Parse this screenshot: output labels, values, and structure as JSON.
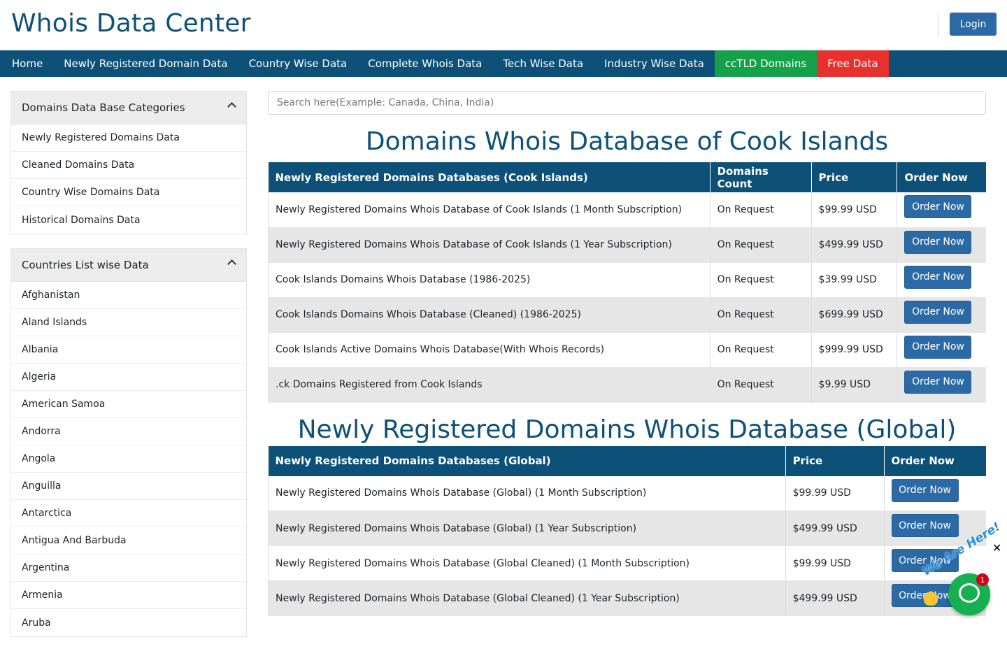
{
  "header": {
    "logo": "Whois Data Center",
    "login_label": "Login"
  },
  "nav": [
    {
      "label": "Home",
      "style": ""
    },
    {
      "label": "Newly Registered Domain Data",
      "style": ""
    },
    {
      "label": "Country Wise Data",
      "style": ""
    },
    {
      "label": "Complete Whois Data",
      "style": ""
    },
    {
      "label": "Tech Wise Data",
      "style": ""
    },
    {
      "label": "Industry Wise Data",
      "style": ""
    },
    {
      "label": "ccTLD Domains",
      "style": "green"
    },
    {
      "label": "Free Data",
      "style": "red"
    }
  ],
  "sidebar": {
    "categories": {
      "title": "Domains Data Base Categories",
      "items": [
        "Newly Registered Domains Data",
        "Cleaned Domains Data",
        "Country Wise Domains Data",
        "Historical Domains Data"
      ]
    },
    "countries": {
      "title": "Countries List wise Data",
      "items": [
        "Afghanistan",
        "Aland Islands",
        "Albania",
        "Algeria",
        "American Samoa",
        "Andorra",
        "Angola",
        "Anguilla",
        "Antarctica",
        "Antigua And Barbuda",
        "Argentina",
        "Armenia",
        "Aruba"
      ]
    }
  },
  "search": {
    "placeholder": "Search here(Example: Canada, China, India)"
  },
  "section1": {
    "title": "Domains Whois Database of Cook Islands",
    "headers": [
      "Newly Registered Domains Databases (Cook Islands)",
      "Domains Count",
      "Price",
      "Order Now"
    ],
    "rows": [
      {
        "name": "Newly Registered Domains Whois Database of Cook Islands (1 Month Subscription)",
        "count": "On Request",
        "price": "$99.99 USD"
      },
      {
        "name": "Newly Registered Domains Whois Database of Cook Islands (1 Year Subscription)",
        "count": "On Request",
        "price": "$499.99 USD"
      },
      {
        "name": "Cook Islands Domains Whois Database (1986-2025)",
        "count": "On Request",
        "price": "$39.99 USD"
      },
      {
        "name": "Cook Islands Domains Whois Database (Cleaned) (1986-2025)",
        "count": "On Request",
        "price": "$699.99 USD"
      },
      {
        "name": "Cook Islands Active Domains Whois Database(With Whois Records)",
        "count": "On Request",
        "price": "$999.99 USD"
      },
      {
        "name": ".ck Domains Registered from Cook Islands",
        "count": "On Request",
        "price": "$9.99 USD"
      }
    ]
  },
  "section2": {
    "title": "Newly Registered Domains Whois Database (Global)",
    "headers": [
      "Newly Registered Domains Databases (Global)",
      "Price",
      "Order Now"
    ],
    "rows": [
      {
        "name": "Newly Registered Domains Whois Database (Global) (1 Month Subscription)",
        "price": "$99.99 USD"
      },
      {
        "name": "Newly Registered Domains Whois Database (Global) (1 Year Subscription)",
        "price": "$499.99 USD"
      },
      {
        "name": "Newly Registered Domains Whois Database (Global Cleaned) (1 Month Subscription)",
        "price": "$99.99 USD"
      },
      {
        "name": "Newly Registered Domains Whois Database (Global Cleaned) (1 Year Subscription)",
        "price": "$499.99 USD"
      }
    ]
  },
  "order_label": "Order Now",
  "chat": {
    "text": "We Are Here!",
    "badge": "1",
    "close": "✕"
  },
  "colors": {
    "brand": "#0d5078",
    "button": "#2c6aa6",
    "green": "#15a04a",
    "red": "#e8302f"
  }
}
